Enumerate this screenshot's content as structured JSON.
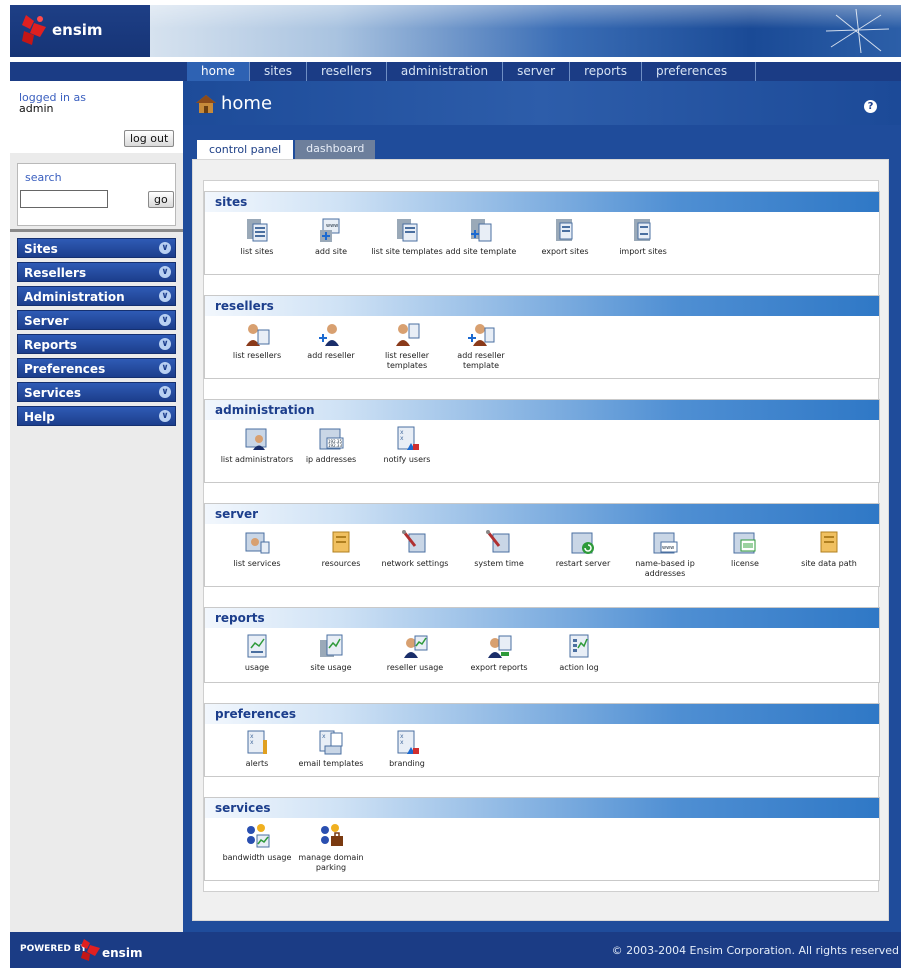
{
  "brand": {
    "name": "ensim"
  },
  "nav": {
    "tabs": [
      "home",
      "sites",
      "resellers",
      "administration",
      "server",
      "reports",
      "preferences"
    ],
    "active": "home"
  },
  "sidebar": {
    "logged_in_label": "logged in as",
    "user": "admin",
    "logout_label": "log out",
    "search_label": "search",
    "search_value": "",
    "go_label": "go",
    "menu": [
      "Sites",
      "Resellers",
      "Administration",
      "Server",
      "Reports",
      "Preferences",
      "Services",
      "Help"
    ]
  },
  "page": {
    "title": "home",
    "help": "?",
    "tabs": [
      "control panel",
      "dashboard"
    ]
  },
  "sections": [
    {
      "title": "sites",
      "items": [
        "list sites",
        "add site",
        "list site templates",
        "add site template",
        "export sites",
        "import sites"
      ]
    },
    {
      "title": "resellers",
      "items": [
        "list resellers",
        "add reseller",
        "list reseller templates",
        "add reseller template"
      ]
    },
    {
      "title": "administration",
      "items": [
        "list administrators",
        "ip addresses",
        "notify users"
      ]
    },
    {
      "title": "server",
      "items": [
        "list services",
        "resources",
        "network settings",
        "system time",
        "restart server",
        "name-based ip addresses",
        "license",
        "site data path"
      ]
    },
    {
      "title": "reports",
      "items": [
        "usage",
        "site usage",
        "reseller usage",
        "export reports",
        "action log"
      ]
    },
    {
      "title": "preferences",
      "items": [
        "alerts",
        "email templates",
        "branding"
      ]
    },
    {
      "title": "services",
      "items": [
        "bandwidth usage",
        "manage domain parking"
      ]
    }
  ],
  "footer": {
    "powered_by": "POWERED BY",
    "logo_text": "ensim",
    "copyright": "© 2003-2004 Ensim Corporation. All rights reserved"
  }
}
